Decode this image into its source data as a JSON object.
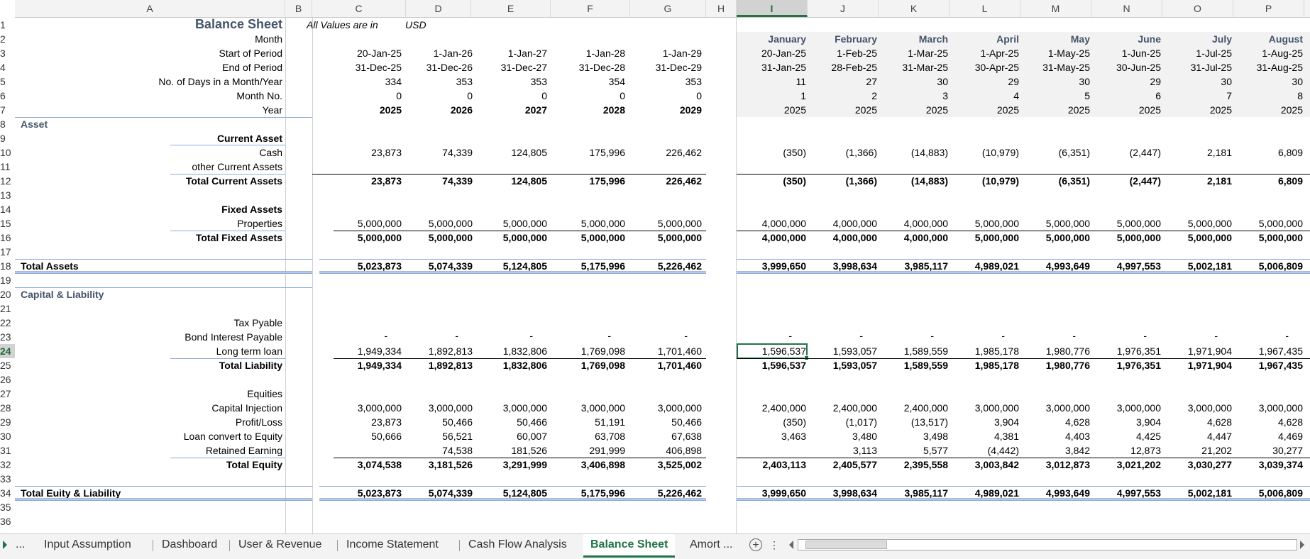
{
  "columns": [
    "A",
    "B",
    "C",
    "D",
    "E",
    "F",
    "G",
    "H",
    "I",
    "J",
    "K",
    "L",
    "M",
    "N",
    "O",
    "P"
  ],
  "selected_column": "I",
  "selected_row": "24",
  "row_numbers": [
    "1",
    "2",
    "3",
    "4",
    "5",
    "6",
    "7",
    "8",
    "9",
    "10",
    "11",
    "12",
    "13",
    "14",
    "15",
    "16",
    "17",
    "18",
    "19",
    "20",
    "21",
    "22",
    "23",
    "24",
    "25",
    "26",
    "27",
    "28",
    "29",
    "30",
    "31",
    "32",
    "33",
    "34",
    "35",
    "36"
  ],
  "header": {
    "title": "Balance Sheet",
    "note_label": "All Values are in",
    "currency": "USD"
  },
  "header_rows": [
    {
      "label": "Month",
      "annual": [
        "",
        "",
        "",
        "",
        ""
      ],
      "monthly": [
        "January",
        "February",
        "March",
        "April",
        "May",
        "June",
        "July",
        "August"
      ],
      "bold": true
    },
    {
      "label": "Start of Period",
      "annual": [
        "20-Jan-25",
        "1-Jan-26",
        "1-Jan-27",
        "1-Jan-28",
        "1-Jan-29"
      ],
      "monthly": [
        "20-Jan-25",
        "1-Feb-25",
        "1-Mar-25",
        "1-Apr-25",
        "1-May-25",
        "1-Jun-25",
        "1-Jul-25",
        "1-Aug-25"
      ]
    },
    {
      "label": "End of Period",
      "annual": [
        "31-Dec-25",
        "31-Dec-26",
        "31-Dec-27",
        "31-Dec-28",
        "31-Dec-29"
      ],
      "monthly": [
        "31-Jan-25",
        "28-Feb-25",
        "31-Mar-25",
        "30-Apr-25",
        "31-May-25",
        "30-Jun-25",
        "31-Jul-25",
        "31-Aug-25"
      ]
    },
    {
      "label": "No. of Days in a Month/Year",
      "annual": [
        "334",
        "353",
        "353",
        "354",
        "353"
      ],
      "monthly": [
        "11",
        "27",
        "30",
        "29",
        "30",
        "29",
        "30",
        "30"
      ]
    },
    {
      "label": "Month No.",
      "annual": [
        "0",
        "0",
        "0",
        "0",
        "0"
      ],
      "monthly": [
        "1",
        "2",
        "3",
        "4",
        "5",
        "6",
        "7",
        "8"
      ]
    },
    {
      "label": "Year",
      "annual": [
        "2025",
        "2026",
        "2027",
        "2028",
        "2029"
      ],
      "monthly": [
        "2025",
        "2025",
        "2025",
        "2025",
        "2025",
        "2025",
        "2025",
        "2025"
      ],
      "bold_annual": true
    }
  ],
  "sections": {
    "asset": "Asset",
    "current_asset": "Current Asset",
    "fixed_assets": "Fixed Assets",
    "total_assets": "Total Assets",
    "capital_liability": "Capital & Liability",
    "equities": "Equities",
    "total_equity_liability": "Total Euity & Liability"
  },
  "data_rows": {
    "cash": {
      "label": "Cash",
      "annual": [
        "23,873",
        "74,339",
        "124,805",
        "175,996",
        "226,462"
      ],
      "monthly": [
        "(350)",
        "(1,366)",
        "(14,883)",
        "(10,979)",
        "(6,351)",
        "(2,447)",
        "2,181",
        "6,809"
      ]
    },
    "other_current": {
      "label": "other Current Assets",
      "annual": [
        "",
        "",
        "",
        "",
        ""
      ],
      "monthly": [
        "",
        "",
        "",
        "",
        "",
        "",
        "",
        ""
      ]
    },
    "total_current": {
      "label": "Total Current Assets",
      "annual": [
        "23,873",
        "74,339",
        "124,805",
        "175,996",
        "226,462"
      ],
      "monthly": [
        "(350)",
        "(1,366)",
        "(14,883)",
        "(10,979)",
        "(6,351)",
        "(2,447)",
        "2,181",
        "6,809"
      ]
    },
    "properties": {
      "label": "Properties",
      "annual": [
        "5,000,000",
        "5,000,000",
        "5,000,000",
        "5,000,000",
        "5,000,000"
      ],
      "monthly": [
        "4,000,000",
        "4,000,000",
        "4,000,000",
        "5,000,000",
        "5,000,000",
        "5,000,000",
        "5,000,000",
        "5,000,000"
      ]
    },
    "total_fixed": {
      "label": "Total Fixed Assets",
      "annual": [
        "5,000,000",
        "5,000,000",
        "5,000,000",
        "5,000,000",
        "5,000,000"
      ],
      "monthly": [
        "4,000,000",
        "4,000,000",
        "4,000,000",
        "5,000,000",
        "5,000,000",
        "5,000,000",
        "5,000,000",
        "5,000,000"
      ]
    },
    "total_assets": {
      "label": "",
      "annual": [
        "5,023,873",
        "5,074,339",
        "5,124,805",
        "5,175,996",
        "5,226,462"
      ],
      "monthly": [
        "3,999,650",
        "3,998,634",
        "3,985,117",
        "4,989,021",
        "4,993,649",
        "4,997,553",
        "5,002,181",
        "5,006,809"
      ]
    },
    "tax_payable": {
      "label": "Tax Pyable",
      "annual": [
        "",
        "",
        "",
        "",
        ""
      ],
      "monthly": [
        "",
        "",
        "",
        "",
        "",
        "",
        "",
        ""
      ]
    },
    "bond_interest": {
      "label": "Bond Interest Payable",
      "annual": [
        "-",
        "-",
        "-",
        "-",
        "-"
      ],
      "monthly": [
        "-",
        "-",
        "-",
        "-",
        "-",
        "-",
        "-",
        "-"
      ]
    },
    "long_term_loan": {
      "label": "Long term loan",
      "annual": [
        "1,949,334",
        "1,892,813",
        "1,832,806",
        "1,769,098",
        "1,701,460"
      ],
      "monthly": [
        "1,596,537",
        "1,593,057",
        "1,589,559",
        "1,985,178",
        "1,980,776",
        "1,976,351",
        "1,971,904",
        "1,967,435"
      ]
    },
    "total_liability": {
      "label": "Total Liability",
      "annual": [
        "1,949,334",
        "1,892,813",
        "1,832,806",
        "1,769,098",
        "1,701,460"
      ],
      "monthly": [
        "1,596,537",
        "1,593,057",
        "1,589,559",
        "1,985,178",
        "1,980,776",
        "1,976,351",
        "1,971,904",
        "1,967,435"
      ]
    },
    "capital_injection": {
      "label": "Capital Injection",
      "annual": [
        "3,000,000",
        "3,000,000",
        "3,000,000",
        "3,000,000",
        "3,000,000"
      ],
      "monthly": [
        "2,400,000",
        "2,400,000",
        "2,400,000",
        "3,000,000",
        "3,000,000",
        "3,000,000",
        "3,000,000",
        "3,000,000"
      ]
    },
    "profit_loss": {
      "label": "Profit/Loss",
      "annual": [
        "23,873",
        "50,466",
        "50,466",
        "51,191",
        "50,466"
      ],
      "monthly": [
        "(350)",
        "(1,017)",
        "(13,517)",
        "3,904",
        "4,628",
        "3,904",
        "4,628",
        "4,628"
      ]
    },
    "loan_convert": {
      "label": "Loan convert to Equity",
      "annual": [
        "50,666",
        "56,521",
        "60,007",
        "63,708",
        "67,638"
      ],
      "monthly": [
        "3,463",
        "3,480",
        "3,498",
        "4,381",
        "4,403",
        "4,425",
        "4,447",
        "4,469"
      ]
    },
    "retained_earning": {
      "label": "Retained Earning",
      "annual": [
        "",
        "74,538",
        "181,526",
        "291,999",
        "406,898"
      ],
      "monthly": [
        "",
        "3,113",
        "5,577",
        "(4,442)",
        "3,842",
        "12,873",
        "21,202",
        "30,277"
      ]
    },
    "total_equity": {
      "label": "Total Equity",
      "annual": [
        "3,074,538",
        "3,181,526",
        "3,291,999",
        "3,406,898",
        "3,525,002"
      ],
      "monthly": [
        "2,403,113",
        "2,405,577",
        "2,395,558",
        "3,003,842",
        "3,012,873",
        "3,021,202",
        "3,030,277",
        "3,039,374"
      ]
    },
    "total_equity_liability": {
      "label": "",
      "annual": [
        "5,023,873",
        "5,074,339",
        "5,124,805",
        "5,175,996",
        "5,226,462"
      ],
      "monthly": [
        "3,999,650",
        "3,998,634",
        "3,985,117",
        "4,989,021",
        "4,993,649",
        "4,997,553",
        "5,002,181",
        "5,006,809"
      ]
    }
  },
  "tabs": {
    "ellipsis": "...",
    "items": [
      "Input Assumption",
      "Dashboard",
      "User & Revenue",
      "Income Statement",
      "Cash Flow Analysis",
      "Balance Sheet",
      "Amort ..."
    ],
    "active": "Balance Sheet",
    "add": "+",
    "more": "⋮"
  },
  "colors": {
    "accent": "#217346",
    "heading": "#44546a",
    "shade": "#f2f2f2"
  }
}
